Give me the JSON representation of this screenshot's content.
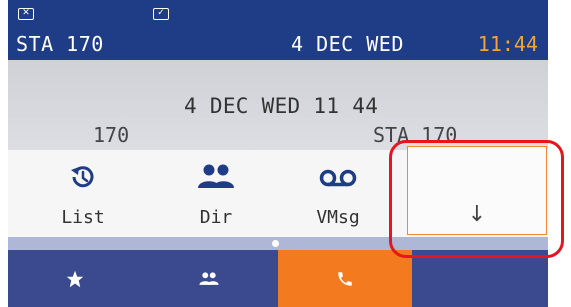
{
  "status_bar": {
    "station": "STA 170",
    "date": "4 DEC WED",
    "time": "11:44",
    "missed_icon": "missed-call-icon",
    "check_icon": "check-icon"
  },
  "idle": {
    "datetime": "4 DEC WED 11 44",
    "extension": "170",
    "station": "STA 170"
  },
  "softkeys": [
    {
      "label": "List",
      "icon": "history-icon"
    },
    {
      "label": "Dir",
      "icon": "contacts-icon"
    },
    {
      "label": "VMsg",
      "icon": "voicemail-icon"
    },
    {
      "label": "",
      "arrow": "↓"
    }
  ],
  "bottom_keys": [
    {
      "icon": "star-icon"
    },
    {
      "icon": "contacts-icon"
    },
    {
      "icon": "phone-icon"
    },
    {
      "icon": ""
    }
  ],
  "colors": {
    "status_bar": "#1e3d86",
    "time": "#f4a23a",
    "accent": "#f47a1f",
    "highlight": "#e8141e",
    "bottom_bar": "#3b4a8e"
  }
}
